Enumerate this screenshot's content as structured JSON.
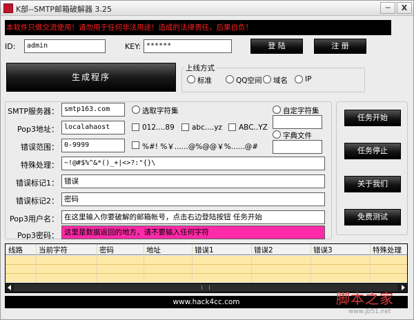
{
  "window": {
    "title": "K部--SMTP邮箱破解器 3.25",
    "minimize_label": "─",
    "close_label": "X"
  },
  "warning": "本软件只做交流使用！请勿用于任何非法用途！造成的法律责任，后果自负！",
  "login": {
    "id_label": "ID:",
    "id_value": "admin",
    "key_label": "KEY:",
    "key_value": "******",
    "login_button": "登 陆",
    "register_button": "注 册"
  },
  "generate_button": "生成程序",
  "online_mode": {
    "title": "上线方式",
    "options": [
      "标准",
      "QQ空间",
      "域名",
      "IP"
    ]
  },
  "form": {
    "smtp_label": "SMTP服务器：",
    "smtp_value": "smtp163.com",
    "pop3_label": "Pop3地址：",
    "pop3_value": "localahaost",
    "error_range_label": "错误范围：",
    "error_range_value": "0-9999",
    "special_label": "特殊处理：",
    "special_value": "~!@#$%^&*()_+|<>?:\"{}\\",
    "error_mark1_label": "错误标记1：",
    "error_mark1_value": "错误",
    "error_mark2_label": "错误标记2：",
    "error_mark2_value": "密码",
    "pop3_user_label": "Pop3用户名：",
    "pop3_user_value": "在这里输入你要破解的邮箱帐号，点击右边登陆按钮 任务开始",
    "pop3_pass_label": "Pop3密码：",
    "pop3_pass_value": "这里是数据返回的地方，请不要输入任何字符"
  },
  "charset": {
    "select_label": "选取字符集",
    "digits_label": "012....89",
    "lower_label": "abc....yz",
    "upper_label": "ABC..YZ",
    "symbols_label": "%#! %￥......@%@@￥%......@#",
    "custom_label": "自定字符集",
    "dict_label": "字典文件"
  },
  "side_buttons": {
    "start": "任务开始",
    "stop": "任务停止",
    "about": "关于我们",
    "free_test": "免费测试"
  },
  "table": {
    "columns": [
      "线路",
      "当前字符",
      "密码",
      "地址",
      "错误1",
      "错误2",
      "错误3",
      "特殊处理"
    ]
  },
  "footer": "www.hack4cc.com",
  "watermark": {
    "main": "脚本之家",
    "sub": "www.jb51.net"
  }
}
